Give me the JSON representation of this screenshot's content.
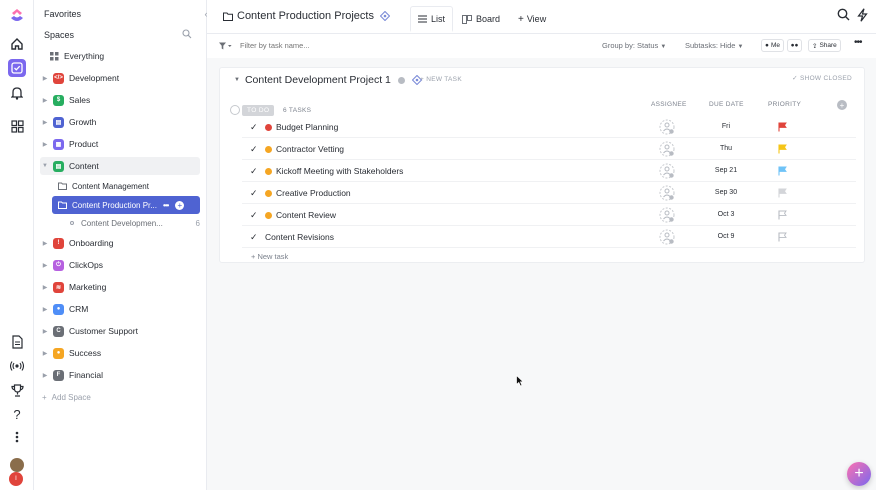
{
  "sidebar": {
    "favorites": "Favorites",
    "spaces": "Spaces",
    "everything": "Everything",
    "items": [
      {
        "label": "Development",
        "color": "#e0443b",
        "glyph": "</>"
      },
      {
        "label": "Sales",
        "color": "#27ae60",
        "glyph": "$"
      },
      {
        "label": "Growth",
        "color": "#4f63d2",
        "glyph": "▤"
      },
      {
        "label": "Product",
        "color": "#7b68ee",
        "glyph": "▦"
      },
      {
        "label": "Content",
        "color": "#27ae60",
        "glyph": "▤"
      },
      {
        "label": "Onboarding",
        "color": "#e0443b",
        "glyph": "!"
      },
      {
        "label": "ClickOps",
        "color": "#b660e0",
        "glyph": "⏻"
      },
      {
        "label": "Marketing",
        "color": "#e0443b",
        "glyph": "≋"
      },
      {
        "label": "CRM",
        "color": "#4f8ef7",
        "glyph": "●"
      },
      {
        "label": "Customer Support",
        "color": "#6b6f76",
        "glyph": "C"
      },
      {
        "label": "Success",
        "color": "#f5a623",
        "glyph": "●"
      },
      {
        "label": "Financial",
        "color": "#6b6f76",
        "glyph": "F"
      }
    ],
    "content_children": {
      "folder1": "Content Management",
      "folder2": "Content Production Pr...",
      "list": "Content Developmen...",
      "list_count": "6"
    },
    "add_space": "Add Space",
    "avatar_letter": "I"
  },
  "topbar": {
    "breadcrumb": "Content Production Projects",
    "tabs": {
      "list": "List",
      "board": "Board",
      "add_view": "View"
    }
  },
  "toolbar": {
    "filter_placeholder": "Filter by task name...",
    "group_by": "Group by: Status",
    "subtasks": "Subtasks: Hide",
    "me": "Me",
    "share": "Share"
  },
  "list": {
    "title": "Content Development Project 1",
    "new_task_top": "+ NEW TASK",
    "show_closed": "SHOW CLOSED",
    "status": "TO DO",
    "task_count": "6 TASKS",
    "columns": {
      "assignee": "ASSIGNEE",
      "due": "DUE DATE",
      "priority": "PRIORITY"
    },
    "new_task_bottom": "+ New task",
    "tasks": [
      {
        "name": "Budget Planning",
        "due": "Fri",
        "status_color": "#e0443b",
        "priority_color": "#e0443b",
        "priority_filled": true
      },
      {
        "name": "Contractor Vetting",
        "due": "Thu",
        "status_color": "#f5a623",
        "priority_color": "#f5c518",
        "priority_filled": true
      },
      {
        "name": "Kickoff Meeting with Stakeholders",
        "due": "Sep 21",
        "status_color": "#f5a623",
        "priority_color": "#6fc3f7",
        "priority_filled": true
      },
      {
        "name": "Creative Production",
        "due": "Sep 30",
        "status_color": "#f5a623",
        "priority_color": "#d3d5d9",
        "priority_filled": true
      },
      {
        "name": "Content Review",
        "due": "Oct 3",
        "status_color": "#f5a623",
        "priority_color": "#b8bcc3",
        "priority_filled": false
      },
      {
        "name": "Content Revisions",
        "due": "Oct 9",
        "status_color": "",
        "priority_color": "#b8bcc3",
        "priority_filled": false
      }
    ]
  }
}
